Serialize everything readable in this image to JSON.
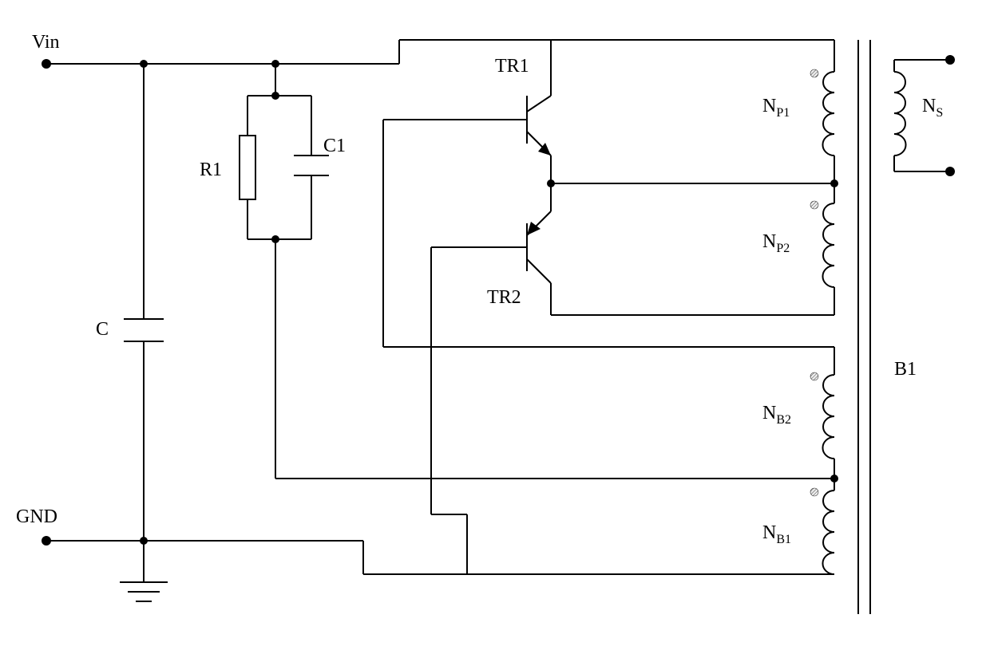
{
  "labels": {
    "vin": "Vin",
    "gnd": "GND",
    "c": "C",
    "r1": "R1",
    "c1": "C1",
    "tr1": "TR1",
    "tr2": "TR2",
    "np1_base": "N",
    "np1_sub": "P1",
    "np2_base": "N",
    "np2_sub": "P2",
    "nb1_base": "N",
    "nb1_sub": "B1",
    "nb2_base": "N",
    "nb2_sub": "B2",
    "ns_base": "N",
    "ns_sub": "S",
    "b1": "B1"
  },
  "components": {
    "type": "push-pull self-oscillating converter (Royer)",
    "input": "Vin / GND",
    "transistors": [
      "TR1",
      "TR2"
    ],
    "passives": [
      "C",
      "R1",
      "C1"
    ],
    "transformer": "B1",
    "primary_windings": [
      "N_P1",
      "N_P2"
    ],
    "feedback_windings": [
      "N_B1",
      "N_B2"
    ],
    "secondary": "N_S"
  }
}
